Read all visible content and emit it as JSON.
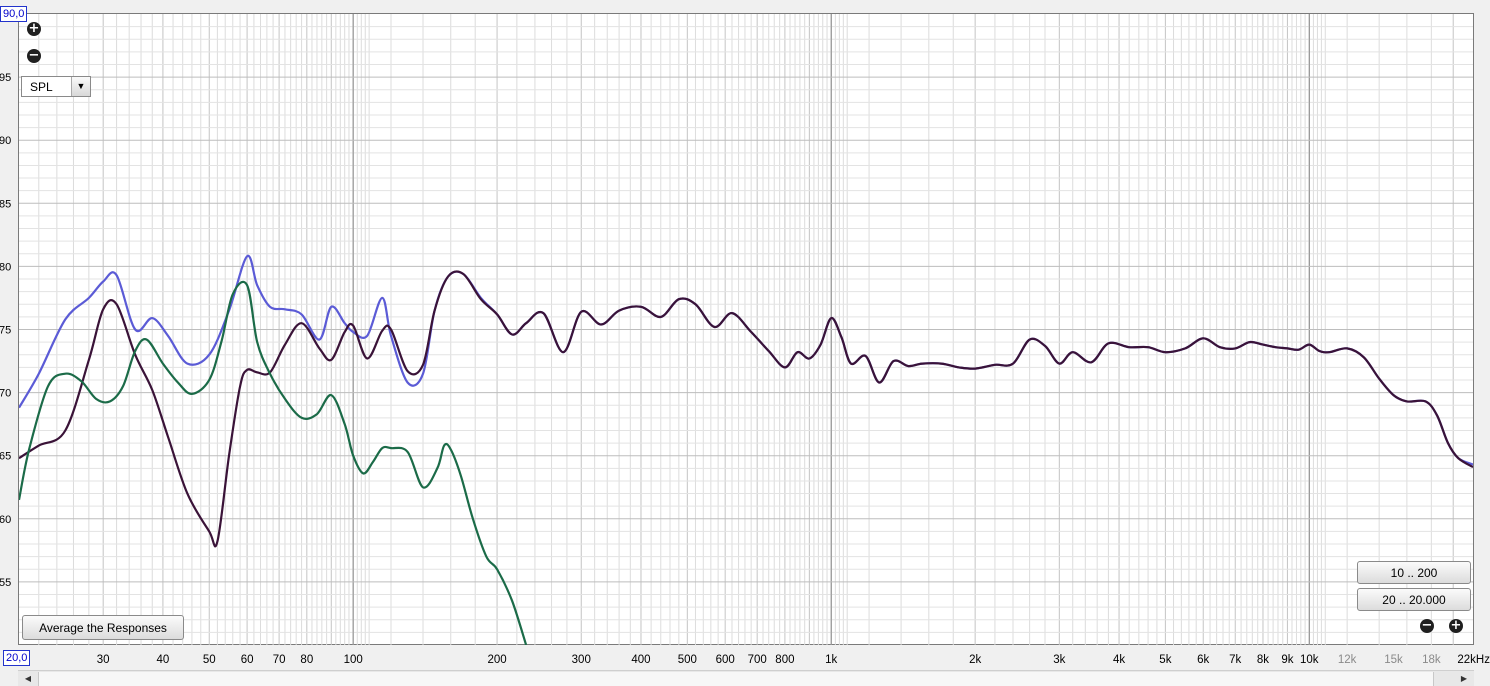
{
  "corner_top_label": "90,0",
  "corner_bottom_label": "20,0",
  "zoom_in_icon": "zoom-in-icon",
  "zoom_out_icon": "zoom-out-icon",
  "measure_select": {
    "value": "SPL"
  },
  "buttons": {
    "average": "Average the Responses",
    "range_low": "10 .. 200",
    "range_full": "20 .. 20.000"
  },
  "colors": {
    "grid_major": "#8c8c8c",
    "grid_minor": "#dcdcdc",
    "series_blue": "#5b5bd6",
    "series_dark": "#3a1338",
    "series_green": "#1b6b48"
  },
  "chart_data": {
    "type": "line",
    "x_scale": "log",
    "xlim": [
      20,
      22000
    ],
    "ylim": [
      50,
      100
    ],
    "grid": true,
    "x_ticks": [
      {
        "v": 30,
        "label": "30"
      },
      {
        "v": 40,
        "label": "40"
      },
      {
        "v": 50,
        "label": "50"
      },
      {
        "v": 60,
        "label": "60"
      },
      {
        "v": 70,
        "label": "70"
      },
      {
        "v": 80,
        "label": "80"
      },
      {
        "v": 100,
        "label": "100"
      },
      {
        "v": 200,
        "label": "200"
      },
      {
        "v": 300,
        "label": "300"
      },
      {
        "v": 400,
        "label": "400"
      },
      {
        "v": 500,
        "label": "500"
      },
      {
        "v": 600,
        "label": "600"
      },
      {
        "v": 700,
        "label": "700"
      },
      {
        "v": 800,
        "label": "800"
      },
      {
        "v": 1000,
        "label": "1k"
      },
      {
        "v": 2000,
        "label": "2k"
      },
      {
        "v": 3000,
        "label": "3k"
      },
      {
        "v": 4000,
        "label": "4k"
      },
      {
        "v": 5000,
        "label": "5k"
      },
      {
        "v": 6000,
        "label": "6k"
      },
      {
        "v": 7000,
        "label": "7k"
      },
      {
        "v": 8000,
        "label": "8k"
      },
      {
        "v": 9000,
        "label": "9k"
      },
      {
        "v": 10000,
        "label": "10k"
      },
      {
        "v": 12000,
        "label": "12k"
      },
      {
        "v": 15000,
        "label": "15k"
      },
      {
        "v": 18000,
        "label": "18k"
      },
      {
        "v": 22000,
        "label": "22kHz"
      }
    ],
    "y_ticks": [
      {
        "v": 95,
        "label": "95"
      },
      {
        "v": 90,
        "label": "90"
      },
      {
        "v": 85,
        "label": "85"
      },
      {
        "v": 80,
        "label": "80"
      },
      {
        "v": 75,
        "label": "75"
      },
      {
        "v": 70,
        "label": "70"
      },
      {
        "v": 65,
        "label": "65"
      },
      {
        "v": 60,
        "label": "60"
      },
      {
        "v": 55,
        "label": "55"
      }
    ],
    "series": [
      {
        "color": "#5b5bd6",
        "x": [
          20,
          22,
          25,
          28,
          30,
          32,
          35,
          38,
          41,
          45,
          50,
          55,
          60,
          63,
          67,
          72,
          78,
          85,
          90,
          96,
          100,
          107,
          115,
          120,
          130,
          140,
          148,
          158,
          170,
          185,
          200,
          215,
          230,
          250,
          275,
          300,
          330,
          360,
          400,
          440,
          480,
          520,
          570,
          620,
          680,
          740,
          800,
          850,
          900,
          950,
          1000,
          1050,
          1100,
          1180,
          1260,
          1350,
          1450,
          1550,
          1700,
          1850,
          2000,
          2200,
          2400,
          2600,
          2800,
          3000,
          3200,
          3500,
          3800,
          4200,
          4600,
          5000,
          5500,
          6000,
          6500,
          7000,
          7500,
          8000,
          8500,
          9000,
          9500,
          10000,
          10500,
          11000,
          12000,
          13000,
          14000,
          15000,
          16000,
          17500,
          18500,
          19500,
          20500,
          22000
        ],
        "y": [
          68.8,
          71.5,
          75.8,
          77.5,
          78.8,
          79.3,
          75,
          75.9,
          74.5,
          72.3,
          73,
          76.5,
          80.8,
          78.5,
          76.8,
          76.6,
          76.2,
          74.2,
          76.8,
          75.5,
          74.8,
          74.5,
          77.5,
          74.5,
          70.8,
          71.5,
          76.5,
          79.2,
          79.4,
          77.5,
          76.2,
          74.6,
          75.5,
          76.3,
          73.2,
          76.4,
          75.4,
          76.5,
          76.8,
          76,
          77.4,
          77,
          75.2,
          76.3,
          74.8,
          73.3,
          72,
          73.2,
          72.7,
          73.8,
          75.9,
          74.4,
          72.3,
          72.9,
          70.8,
          72.5,
          72.1,
          72.3,
          72.3,
          72,
          71.9,
          72.2,
          72.3,
          74.2,
          73.7,
          72.3,
          73.2,
          72.4,
          73.9,
          73.6,
          73.6,
          73.2,
          73.5,
          74.3,
          73.6,
          73.5,
          74,
          73.8,
          73.6,
          73.5,
          73.4,
          73.8,
          73.3,
          73.2,
          73.5,
          72.8,
          71.1,
          69.8,
          69.3,
          69.3,
          68.2,
          66,
          64.8,
          64.3
        ]
      },
      {
        "color": "#3a1338",
        "x": [
          20,
          22,
          25,
          28,
          30,
          32,
          35,
          38,
          41,
          45,
          50,
          52,
          55,
          58,
          60,
          63,
          67,
          72,
          78,
          85,
          90,
          96,
          100,
          107,
          115,
          120,
          130,
          140,
          148,
          158,
          170,
          185,
          200,
          215,
          230,
          250,
          275,
          300,
          330,
          360,
          400,
          440,
          480,
          520,
          570,
          620,
          680,
          740,
          800,
          850,
          900,
          950,
          1000,
          1050,
          1100,
          1180,
          1260,
          1350,
          1450,
          1550,
          1700,
          1850,
          2000,
          2200,
          2400,
          2600,
          2800,
          3000,
          3200,
          3500,
          3800,
          4200,
          4600,
          5000,
          5500,
          6000,
          6500,
          7000,
          7500,
          8000,
          8500,
          9000,
          9500,
          10000,
          10500,
          11000,
          12000,
          13000,
          14000,
          15000,
          16000,
          17500,
          18500,
          19500,
          20500,
          22000
        ],
        "y": [
          64.8,
          65.8,
          67,
          72.6,
          76.6,
          77,
          73,
          70.2,
          66.5,
          62,
          59,
          58.2,
          65,
          70.5,
          71.8,
          71.6,
          71.6,
          73.8,
          75.5,
          73.5,
          72.6,
          74.8,
          75.3,
          72.7,
          74.9,
          75,
          71.7,
          72.2,
          76.5,
          79.2,
          79.4,
          77.4,
          76.2,
          74.6,
          75.5,
          76.3,
          73.2,
          76.4,
          75.4,
          76.5,
          76.8,
          76,
          77.4,
          77,
          75.2,
          76.3,
          74.8,
          73.3,
          72,
          73.2,
          72.7,
          73.8,
          75.9,
          74.4,
          72.3,
          72.9,
          70.8,
          72.5,
          72.1,
          72.3,
          72.3,
          72,
          71.9,
          72.2,
          72.3,
          74.2,
          73.7,
          72.3,
          73.2,
          72.4,
          73.9,
          73.6,
          73.6,
          73.2,
          73.5,
          74.3,
          73.6,
          73.5,
          74,
          73.8,
          73.6,
          73.5,
          73.4,
          73.8,
          73.3,
          73.2,
          73.5,
          72.8,
          71.1,
          69.8,
          69.3,
          69.3,
          68.2,
          66,
          64.8,
          64.1
        ]
      },
      {
        "color": "#1b6b48",
        "x": [
          20,
          21,
          23,
          25,
          27,
          29,
          31,
          33,
          35,
          37,
          40,
          43,
          46,
          50,
          53,
          56,
          60,
          63,
          67,
          72,
          78,
          84,
          90,
          96,
          100,
          105,
          110,
          115,
          120,
          130,
          140,
          150,
          155,
          160,
          168,
          178,
          190,
          200,
          215,
          230
        ],
        "y": [
          61.5,
          65.5,
          70.5,
          71.5,
          70.9,
          69.5,
          69.3,
          70.5,
          73.3,
          74.2,
          72.3,
          70.8,
          69.9,
          71,
          74,
          77.8,
          78.5,
          74,
          71.5,
          69.5,
          68,
          68.3,
          69.8,
          67.5,
          65,
          63.6,
          64.5,
          65.6,
          65.6,
          65.3,
          62.5,
          64,
          65.8,
          65.5,
          63.4,
          60,
          57,
          56,
          53.5,
          50
        ]
      }
    ]
  }
}
